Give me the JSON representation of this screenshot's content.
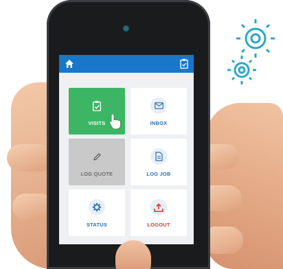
{
  "header": {
    "home_icon": "home-icon",
    "clipboard_icon": "clipboard-check-icon",
    "bar_color": "#1976c8"
  },
  "tiles": [
    {
      "label": "VISITS",
      "icon": "clipboard-check-icon",
      "color": "#3cb664",
      "state": "pressed"
    },
    {
      "label": "INBOX",
      "icon": "envelope-icon"
    },
    {
      "label": "LOG QUOTE",
      "icon": "pencil-icon",
      "state": "disabled"
    },
    {
      "label": "LOG JOB",
      "icon": "document-icon"
    },
    {
      "label": "STATUS",
      "icon": "gear-icon"
    },
    {
      "label": "LOGOUT",
      "icon": "logout-upload-icon",
      "color": "#d63a2e"
    }
  ],
  "colors": {
    "accent": "#1976c8",
    "visits": "#3cb664",
    "logout": "#d63a2e",
    "gears": "#2aa7c6"
  }
}
